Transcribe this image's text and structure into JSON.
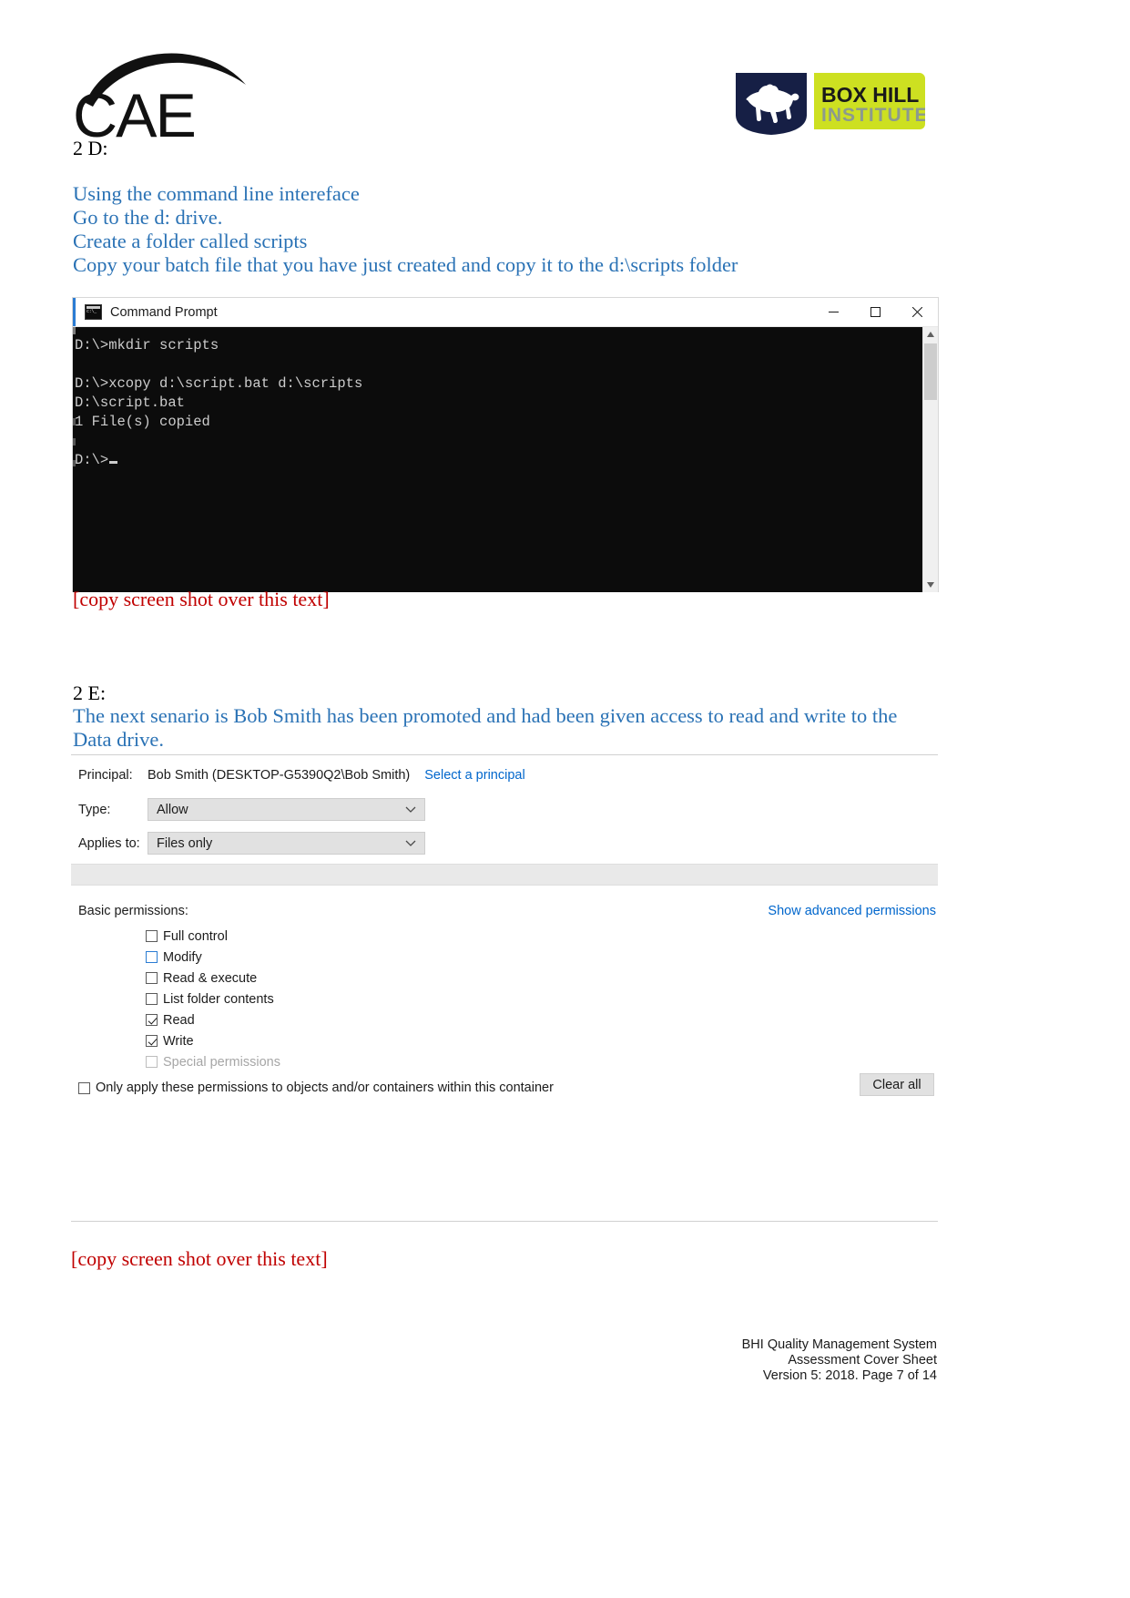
{
  "header": {
    "cae_logo_alt": "CAE",
    "bhi_logo": {
      "line1": "BOX HILL",
      "line2": "INSTITUTE",
      "shield_color": "#161f45",
      "panel_color": "#cde021",
      "line1_color": "#1a1a1a",
      "line2_color": "#8c9a8e"
    }
  },
  "sections": {
    "d": {
      "heading": "2 D:",
      "instructions": [
        "Using the command line intereface",
        "Go to the d: drive.",
        "Create a folder called scripts",
        "Copy your batch file that you have just created and copy it to the  d:\\scripts folder"
      ],
      "placeholder_note": "[copy screen shot over this text]"
    },
    "e": {
      "heading": "2 E:",
      "instruction": "The next senario is Bob Smith has been promoted and had been given access to read and write to the Data drive.",
      "placeholder_note": "[copy screen shot over this text]"
    }
  },
  "cmd_window": {
    "title": "Command Prompt",
    "icon": "cmd-icon",
    "minimize": "minimize-icon",
    "maximize": "maximize-icon",
    "close": "close-icon",
    "lines": [
      "D:\\>mkdir scripts",
      "",
      "D:\\>xcopy d:\\script.bat d:\\scripts",
      "D:\\script.bat",
      "1 File(s) copied",
      "",
      "D:\\>"
    ],
    "background": "#0c0c0c",
    "foreground": "#cccccc"
  },
  "permission_dialog": {
    "principal_label": "Principal:",
    "principal_value": "Bob Smith (DESKTOP-G5390Q2\\Bob Smith)",
    "select_principal_link": "Select a principal",
    "type_label": "Type:",
    "type_value": "Allow",
    "applies_to_label": "Applies to:",
    "applies_to_value": "Files only",
    "basic_permissions_label": "Basic permissions:",
    "show_advanced_link": "Show advanced permissions",
    "permissions": [
      {
        "label": "Full control",
        "checked": false,
        "disabled": false,
        "focused": false
      },
      {
        "label": "Modify",
        "checked": false,
        "disabled": false,
        "focused": true
      },
      {
        "label": "Read & execute",
        "checked": false,
        "disabled": false,
        "focused": false
      },
      {
        "label": "List folder contents",
        "checked": false,
        "disabled": false,
        "focused": false
      },
      {
        "label": "Read",
        "checked": true,
        "disabled": false,
        "focused": false
      },
      {
        "label": "Write",
        "checked": true,
        "disabled": false,
        "focused": false
      },
      {
        "label": "Special permissions",
        "checked": false,
        "disabled": true,
        "focused": false
      }
    ],
    "only_apply_label": "Only apply these permissions to objects and/or containers within this container",
    "only_apply_checked": false,
    "clear_all_label": "Clear all",
    "link_color": "#0066cc"
  },
  "footer": {
    "line1": "BHI Quality Management System",
    "line2": "Assessment Cover Sheet",
    "line3": "Version 5: 2018. Page 7 of 14"
  }
}
